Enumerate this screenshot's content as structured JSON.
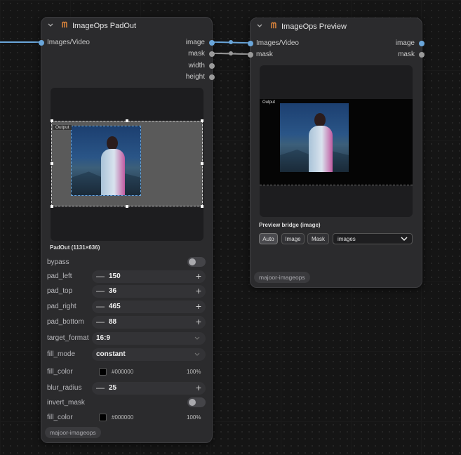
{
  "padout": {
    "title": "ImageOps PadOut",
    "input_label": "Images/Video",
    "outputs": [
      "image",
      "mask",
      "width",
      "height"
    ],
    "output_badge": "Output",
    "caption": "PadOut (1131×636)",
    "widgets": {
      "bypass": "bypass",
      "pad_left": {
        "label": "pad_left",
        "value": "150"
      },
      "pad_top": {
        "label": "pad_top",
        "value": "36"
      },
      "pad_right": {
        "label": "pad_right",
        "value": "465"
      },
      "pad_bottom": {
        "label": "pad_bottom",
        "value": "88"
      },
      "target_format": {
        "label": "target_format",
        "value": "16:9"
      },
      "fill_mode": {
        "label": "fill_mode",
        "value": "constant"
      },
      "fill_color": {
        "label": "fill_color",
        "hex": "#000000",
        "opacity": "100%"
      },
      "blur_radius": {
        "label": "blur_radius",
        "value": "25"
      },
      "invert_mask": "invert_mask",
      "fill_color2": {
        "label": "fill_color",
        "hex": "#000000",
        "opacity": "100%"
      }
    },
    "tag": "majoor-imageops"
  },
  "preview": {
    "title": "ImageOps Preview",
    "inputs": [
      "Images/Video",
      "mask"
    ],
    "outputs": [
      "image",
      "mask"
    ],
    "output_badge": "Output",
    "bridge_label": "Preview bridge (image)",
    "buttons": [
      "Auto",
      "Image",
      "Mask"
    ],
    "select_value": "images",
    "tag": "majoor-imageops"
  },
  "colors": {
    "accent_logo": "#e88b3d",
    "socket_blue": "#6aa6da",
    "socket_grey": "#9a9a9a"
  }
}
